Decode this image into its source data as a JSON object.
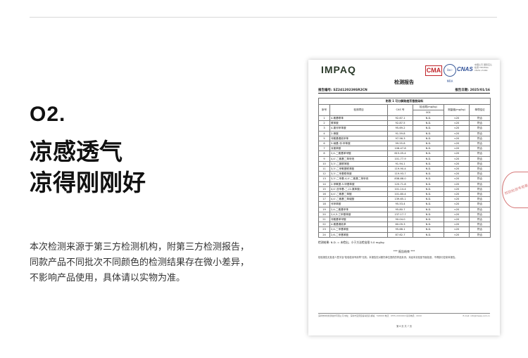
{
  "section_number": "O2.",
  "headline": [
    "凉感透气",
    "凉得刚刚好"
  ],
  "description": [
    "本次检测来源于第三方检测机构，附第三方检测报告，",
    "同款产品不同批次不同颜色的检测结果存在微小差异，",
    "不影响产品使用，具体请以实物为准。"
  ],
  "report": {
    "logo": "IMPAQ",
    "cert_marks": {
      "ma": "CMA",
      "ilac": "ilac-MRA",
      "cnas": "CNAS",
      "cnas_sub": "中国认可 国际互认 检测 TESTING CNAS L5464"
    },
    "title": "检测报告",
    "report_no": "报告编号: SZ24120239SR2CN",
    "report_date": "报告日期: 2025/01/16",
    "table_caption": "附表 1 可分解致癌芳香胺染料",
    "columns": [
      "序号",
      "检测项目",
      "CAS 号",
      "检出限(mg/kg)",
      "测量值(mg/kg)",
      "单项结论"
    ],
    "sample_no": "001",
    "rows": [
      [
        "1",
        "4-氨基联苯",
        "92-67-1",
        "N.D.",
        "<20",
        "符合"
      ],
      [
        "2",
        "联苯胺",
        "92-87-5",
        "N.D.",
        "<20",
        "符合"
      ],
      [
        "3",
        "4-氯邻甲苯胺",
        "95-69-2",
        "N.D.",
        "<20",
        "符合"
      ],
      [
        "4",
        "2-萘胺",
        "91-59-8",
        "N.D.",
        "<20",
        "符合"
      ],
      [
        "5",
        "邻氨基偶氮甲苯",
        "97-56-3",
        "N.D.",
        "<20",
        "符合"
      ],
      [
        "6",
        "5-硝基-邻-甲苯胺",
        "99-55-8",
        "N.D.",
        "<20",
        "符合"
      ],
      [
        "7",
        "对氯苯胺",
        "106-47-8",
        "N.D.",
        "<20",
        "符合"
      ],
      [
        "8",
        "2,4-二氨基苯甲醚",
        "615-05-4",
        "N.D.",
        "<20",
        "符合"
      ],
      [
        "9",
        "4,4'-二氨基二苯甲烷",
        "101-77-9",
        "N.D.",
        "<20",
        "符合"
      ],
      [
        "10",
        "3,3'-二氯联苯胺",
        "91-94-1",
        "N.D.",
        "<20",
        "符合"
      ],
      [
        "11",
        "3,3'-二甲氧基联苯胺",
        "119-90-4",
        "N.D.",
        "<20",
        "符合"
      ],
      [
        "12",
        "3,3'-二甲基联苯胺",
        "119-93-7",
        "N.D.",
        "<20",
        "符合"
      ],
      [
        "13",
        "3,3'-二甲基-4,4'-二氨基二苯甲烷",
        "838-88-0",
        "N.D.",
        "<20",
        "符合"
      ],
      [
        "14",
        "2-甲氧基-5-甲基苯胺",
        "120-71-8",
        "N.D.",
        "<20",
        "符合"
      ],
      [
        "15",
        "4,4'-亚甲基-二-(2-氯苯胺)",
        "101-14-4",
        "N.D.",
        "<20",
        "符合"
      ],
      [
        "16",
        "4,4'-二氨基二苯醚",
        "101-80-4",
        "N.D.",
        "<20",
        "符合"
      ],
      [
        "17",
        "4,4'-二氨基二苯硫醚",
        "139-65-1",
        "N.D.",
        "<20",
        "符合"
      ],
      [
        "18",
        "邻甲苯胺",
        "95-53-4",
        "N.D.",
        "<20",
        "符合"
      ],
      [
        "19",
        "2,4-二氨基甲苯",
        "95-80-7",
        "N.D.",
        "<20",
        "符合"
      ],
      [
        "20",
        "2,4,5-三甲基苯胺",
        "137-17-7",
        "N.D.",
        "<20",
        "符合"
      ],
      [
        "21",
        "邻氨基苯甲醚",
        "90-04-0",
        "N.D.",
        "<20",
        "符合"
      ],
      [
        "22",
        "4-氨基偶氮苯",
        "60-09-3",
        "N.D.",
        "<20",
        "符合"
      ],
      [
        "23",
        "2,4-二甲基苯胺",
        "95-68-1",
        "N.D.",
        "<20",
        "符合"
      ],
      [
        "24",
        "2,6-二甲基苯胺",
        "87-62-7",
        "N.D.",
        "<20",
        "符合"
      ]
    ],
    "note": "检测结果: N.D. = 未检出，小于方法检出限 5.0 mg/kg",
    "end_mark": "*** 报告结束 ***",
    "statement": "检验报告无批准人签字及\"检验检测专用章\"无效；本报告仅对委托单位提供的样品负责；未经本实验室书面批准，不得部分复制本报告。",
    "footer_left": "深圳市中检检测技术有限公司 地址：深圳市宝安区福海街道 邮编：518000 电话：0755-XXXXXXX 投诉电话：XXXX",
    "footer_right": "E-mail: info@impaq.com.cn",
    "page": "第 6 页 共 7 页"
  },
  "stamp_text": "检验检测专用章"
}
